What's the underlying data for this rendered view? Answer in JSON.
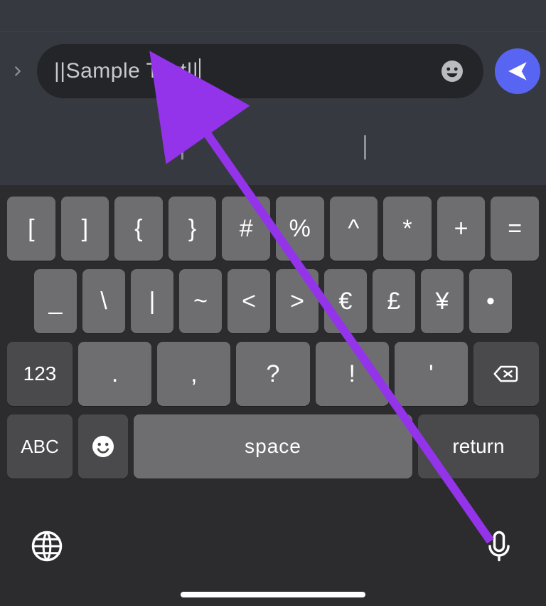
{
  "input": {
    "expand_icon": "chevron-right",
    "text": "||Sample Text||",
    "emoji_icon": "emoji",
    "send_icon": "send"
  },
  "keyboard": {
    "row1": [
      "[",
      "]",
      "{",
      "}",
      "#",
      "%",
      "^",
      "*",
      "+",
      "="
    ],
    "row2": [
      "_",
      "\\",
      "|",
      "~",
      "<",
      ">",
      "€",
      "£",
      "¥",
      "•"
    ],
    "row3": {
      "mode": "123",
      "keys": [
        ".",
        ",",
        "?",
        "!",
        "'"
      ],
      "delete": "⌫"
    },
    "row4": {
      "abc": "ABC",
      "emoji": "😀",
      "space": "space",
      "return": "return"
    },
    "bottom": {
      "globe": "globe",
      "mic": "mic"
    }
  },
  "annotation": {
    "arrow_color": "#9333ea"
  }
}
